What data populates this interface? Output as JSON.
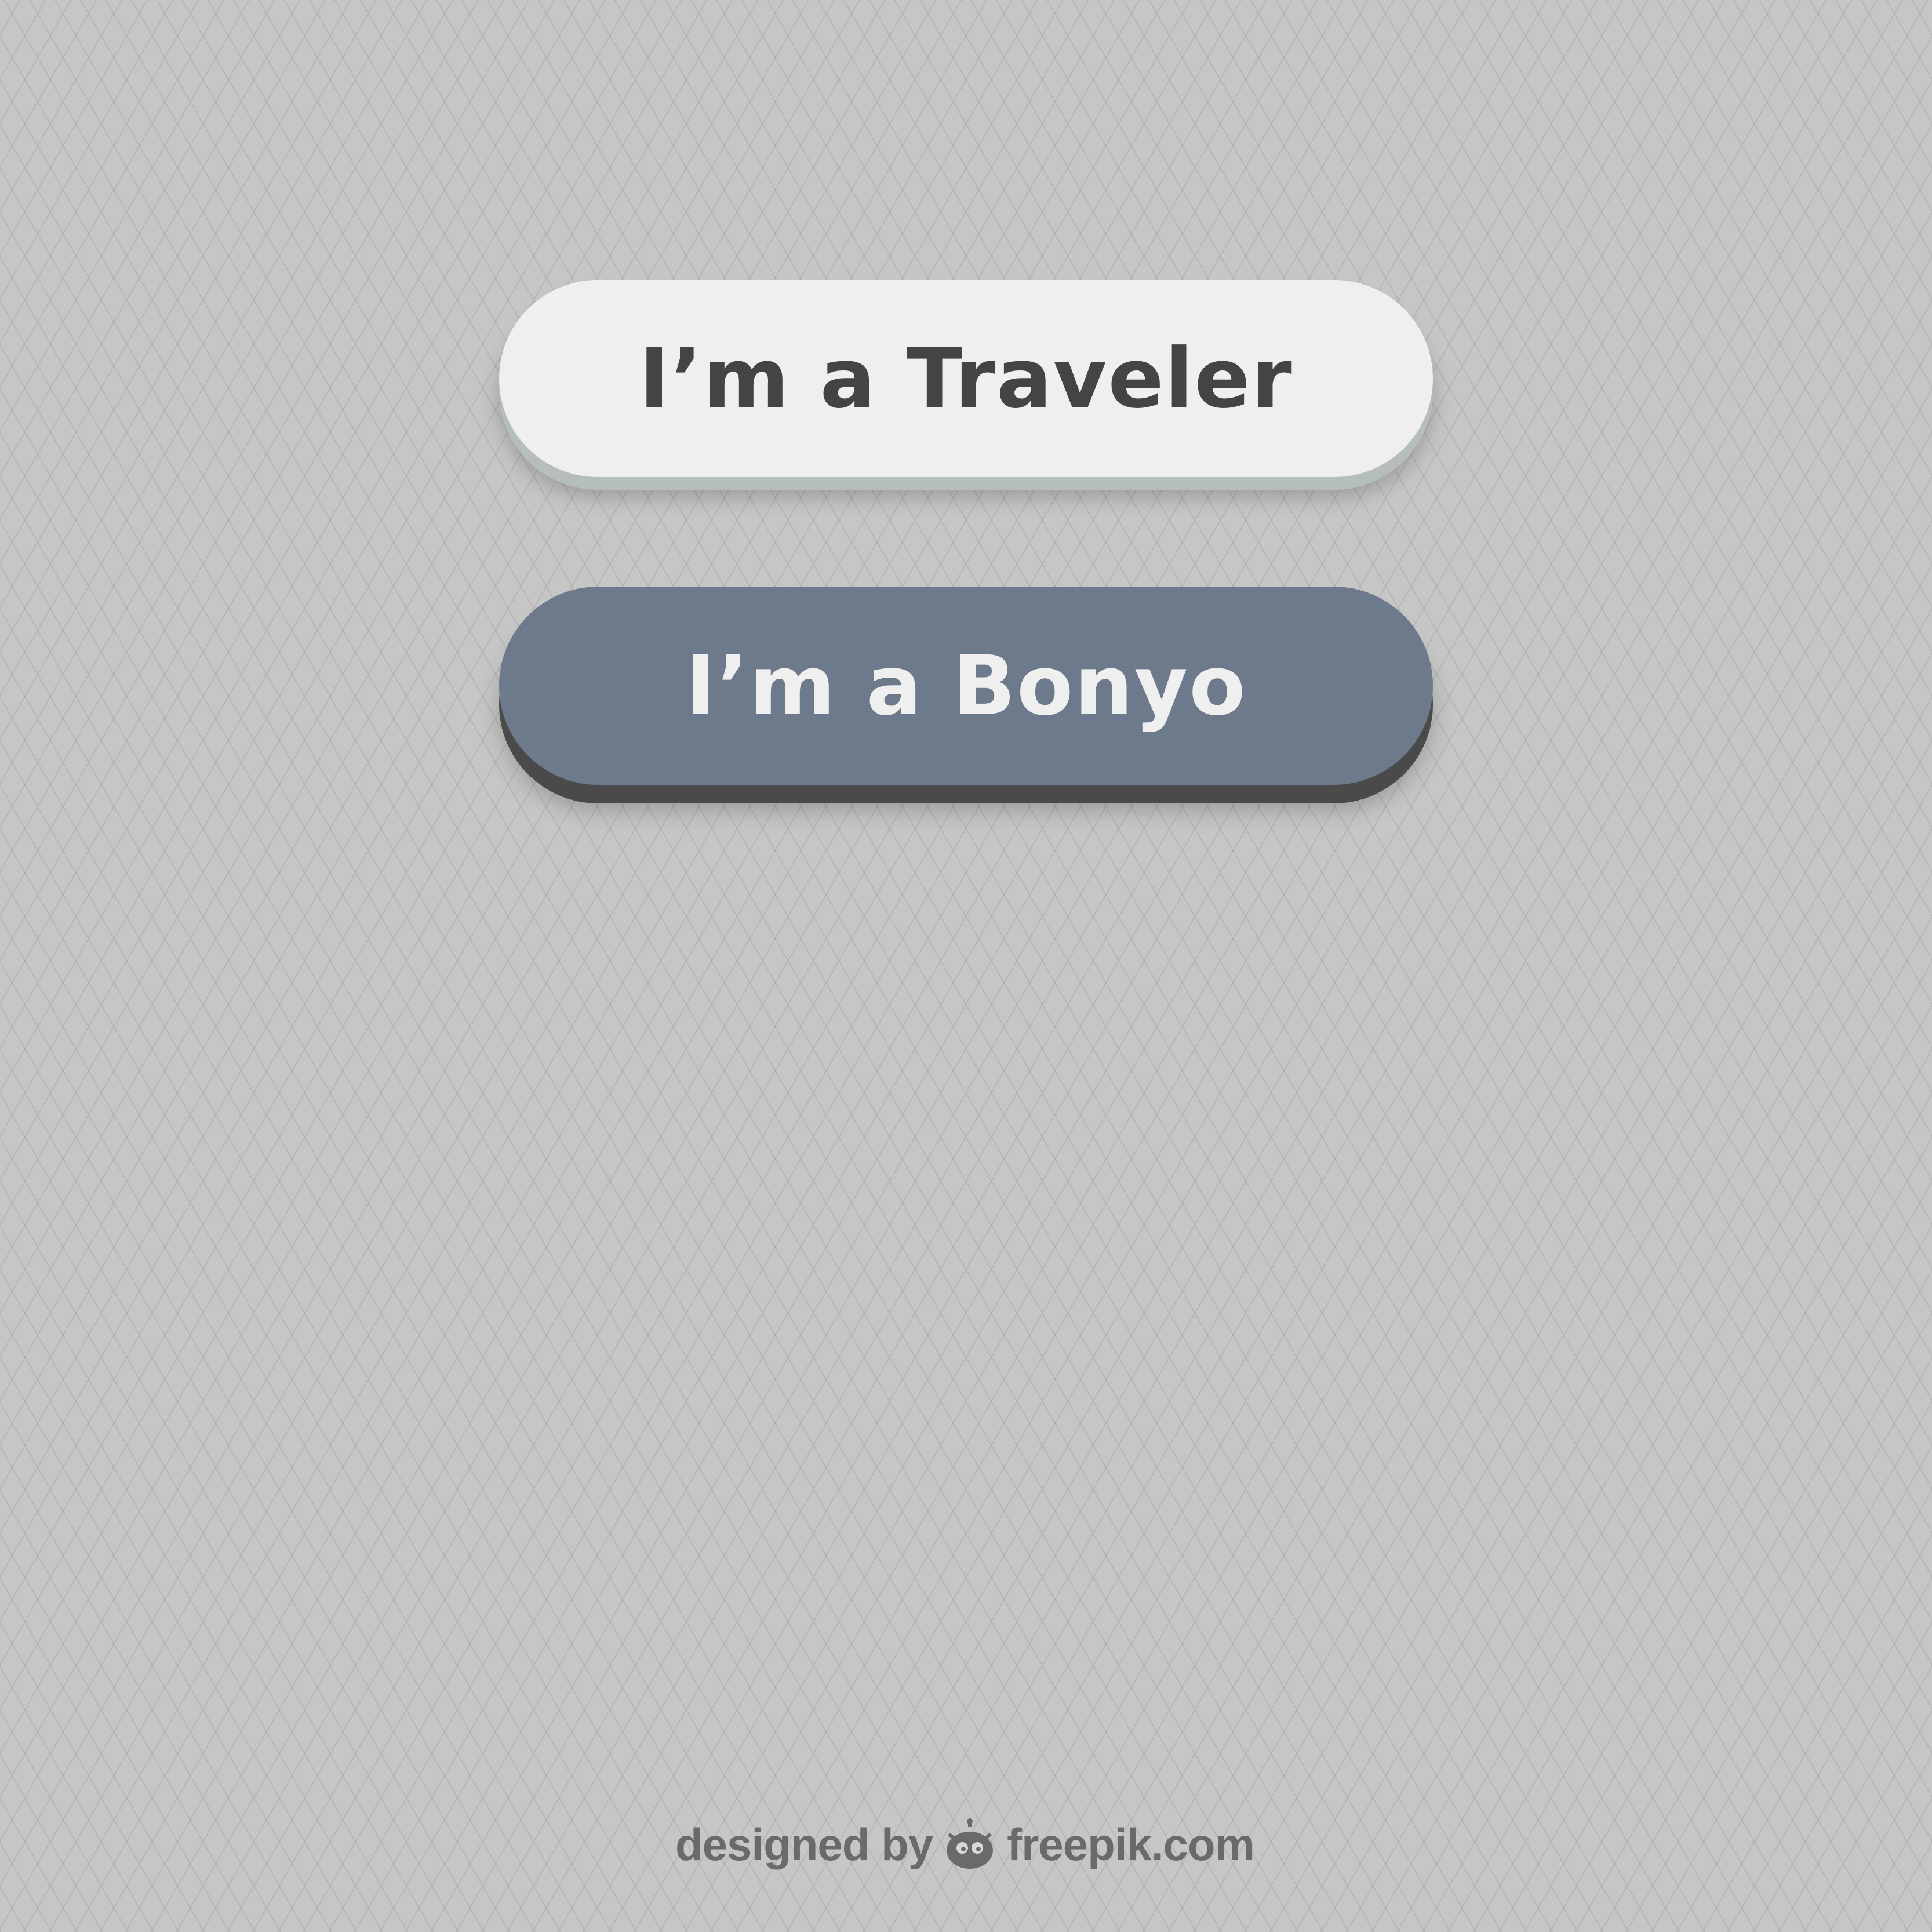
{
  "buttons": {
    "traveler_label": "I’m a Traveler",
    "bonyo_label": "I’m a Bonyo"
  },
  "credit": {
    "prefix": "designed by",
    "brand": "freepik.com",
    "icon": "freepik-logo-icon"
  },
  "colors": {
    "background": "#c6c6c6",
    "light_button": "#efefef",
    "light_button_text": "#444444",
    "dark_button": "#6d7a8b",
    "dark_button_text": "#efefef",
    "credit_text": "#6a6a6a"
  }
}
